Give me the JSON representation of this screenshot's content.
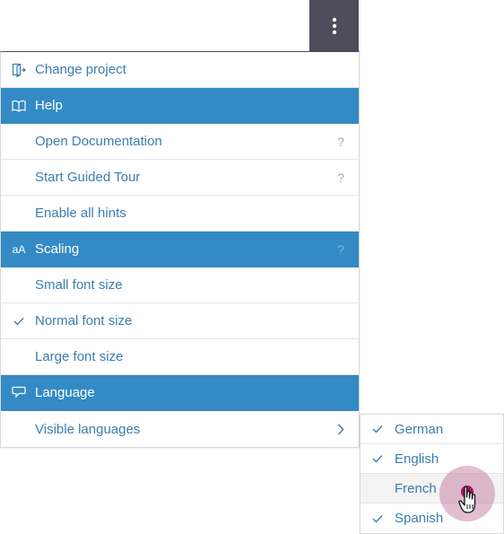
{
  "toolbar": {
    "menu_icon": "more-vertical-icon"
  },
  "menu": {
    "change_project": {
      "label": "Change project",
      "icon": "exit-door-icon"
    },
    "help": {
      "label": "Help",
      "icon": "book-icon",
      "items": [
        {
          "label": "Open Documentation",
          "hint": "?"
        },
        {
          "label": "Start Guided Tour",
          "hint": "?"
        },
        {
          "label": "Enable all hints"
        }
      ]
    },
    "scaling": {
      "label": "Scaling",
      "icon_text": "aA",
      "hint": "?",
      "items": [
        {
          "label": "Small font size",
          "checked": false
        },
        {
          "label": "Normal font size",
          "checked": true
        },
        {
          "label": "Large font size",
          "checked": false
        }
      ]
    },
    "language": {
      "label": "Language",
      "icon": "speech-bubble-icon",
      "items": [
        {
          "label": "Visible languages",
          "has_submenu": true
        }
      ]
    }
  },
  "languages_submenu": {
    "items": [
      {
        "label": "German",
        "checked": true
      },
      {
        "label": "English",
        "checked": true
      },
      {
        "label": "French",
        "checked": false,
        "hovered": true
      },
      {
        "label": "Spanish",
        "checked": true
      }
    ]
  },
  "colors": {
    "header_bg": "#338ac4",
    "link_text": "#3b7db0",
    "toolbar_bg": "#4f4d5c",
    "cursor_highlight": "#a0185e"
  }
}
